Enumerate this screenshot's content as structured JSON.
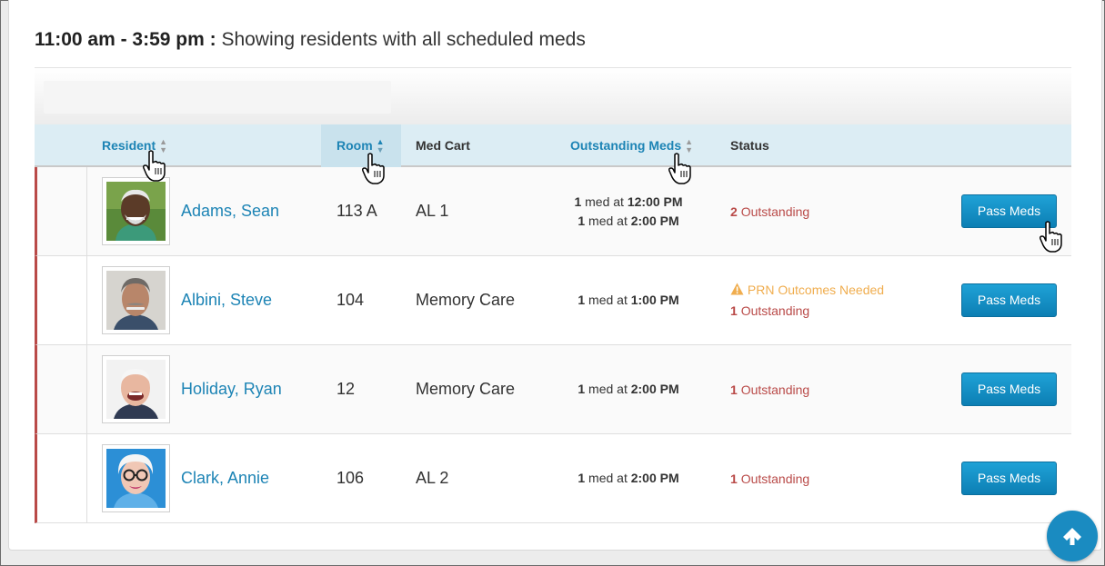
{
  "heading": {
    "time_range": "11:00 am - 3:59 pm :",
    "description": "Showing residents with all scheduled meds"
  },
  "table": {
    "columns": {
      "resident": "Resident",
      "room": "Room",
      "med_cart": "Med Cart",
      "outstanding_meds": "Outstanding Meds",
      "status": "Status"
    },
    "rows": [
      {
        "name": "Adams, Sean",
        "room": "113 A",
        "cart": "AL 1",
        "meds": [
          {
            "count": "1",
            "text": "med at",
            "time": "12:00 PM"
          },
          {
            "count": "1",
            "text": "med at",
            "time": "2:00 PM"
          }
        ],
        "prn": "",
        "outstanding_count": "2",
        "outstanding_label": "Outstanding",
        "button": "Pass Meds"
      },
      {
        "name": "Albini, Steve",
        "room": "104",
        "cart": "Memory Care",
        "meds": [
          {
            "count": "1",
            "text": "med at",
            "time": "1:00 PM"
          }
        ],
        "prn": "PRN Outcomes Needed",
        "outstanding_count": "1",
        "outstanding_label": "Outstanding",
        "button": "Pass Meds"
      },
      {
        "name": "Holiday, Ryan",
        "room": "12",
        "cart": "Memory Care",
        "meds": [
          {
            "count": "1",
            "text": "med at",
            "time": "2:00 PM"
          }
        ],
        "prn": "",
        "outstanding_count": "1",
        "outstanding_label": "Outstanding",
        "button": "Pass Meds"
      },
      {
        "name": "Clark, Annie",
        "room": "106",
        "cart": "AL 2",
        "meds": [
          {
            "count": "1",
            "text": "med at",
            "time": "2:00 PM"
          }
        ],
        "prn": "",
        "outstanding_count": "1",
        "outstanding_label": "Outstanding",
        "button": "Pass Meds"
      }
    ]
  },
  "colors": {
    "link": "#1d84b5",
    "outstanding": "#b94a48",
    "warning": "#f0ad4e",
    "button": "#1a96cc",
    "header_bg": "#dcedf4"
  },
  "icons": [
    "sort-icon",
    "warning-icon",
    "hand-cursor-icon",
    "arrow-up-icon"
  ]
}
